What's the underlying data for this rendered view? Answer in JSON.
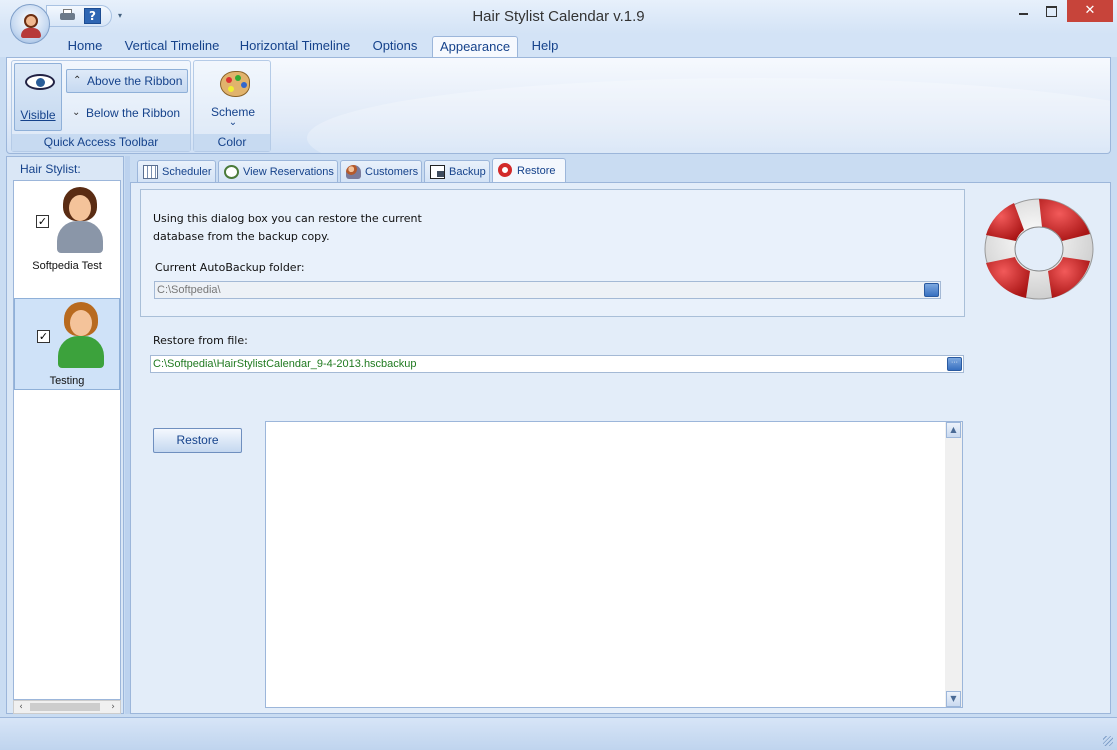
{
  "window": {
    "title": "Hair Stylist Calendar v.1.9",
    "close_symbol": "✕"
  },
  "qat": {
    "help_symbol": "?",
    "dropdown_symbol": "▾"
  },
  "ribbon": {
    "tabs": [
      {
        "label": "Home"
      },
      {
        "label": "Vertical Timeline"
      },
      {
        "label": "Horizontal Timeline"
      },
      {
        "label": "Options"
      },
      {
        "label": "Appearance"
      },
      {
        "label": "Help"
      }
    ],
    "active_tab": "Appearance",
    "groups": {
      "quick_access": {
        "label": "Quick Access Toolbar",
        "visible_label": "Visible",
        "above_label": "Above the Ribbon",
        "below_label": "Below the Ribbon",
        "above_symbol": "⌃",
        "below_symbol": "⌄"
      },
      "color_scheme": {
        "label": "Color Scheme",
        "scheme_label": "Scheme",
        "scheme_symbol": "⌄"
      }
    }
  },
  "left_panel": {
    "header": "Hair Stylist:",
    "stylists": [
      {
        "name": "Softpedia Test",
        "checked": true,
        "check_symbol": "✓"
      },
      {
        "name": "Testing",
        "checked": true,
        "check_symbol": "✓"
      }
    ],
    "scroll_left": "‹",
    "scroll_right": "›"
  },
  "content_tabs": [
    {
      "label": "Scheduler",
      "icon": "calendar-grid-icon"
    },
    {
      "label": "View Reservations",
      "icon": "clock-icon"
    },
    {
      "label": "Customers",
      "icon": "people-icon"
    },
    {
      "label": "Backup",
      "icon": "floppy-disk-icon"
    },
    {
      "label": "Restore",
      "icon": "lifebuoy-icon"
    }
  ],
  "restore_page": {
    "intro_line1": "Using this dialog box you can restore the current",
    "intro_line2": "database from the backup copy.",
    "autobackup_label": "Current AutoBackup folder:",
    "autobackup_value": "C:\\Softpedia\\",
    "restore_from_label": "Restore from file:",
    "restore_from_value": "C:\\Softpedia\\HairStylistCalendar_9-4-2013.hscbackup",
    "browse_symbol": "···",
    "restore_button": "Restore",
    "scroll_up": "▲",
    "scroll_down": "▼"
  },
  "colors": {
    "accent": "#15428b",
    "ribbon_bg": "#dfe9f7",
    "path_text": "#207a20",
    "lifebuoy_red": "#d22a2a"
  }
}
